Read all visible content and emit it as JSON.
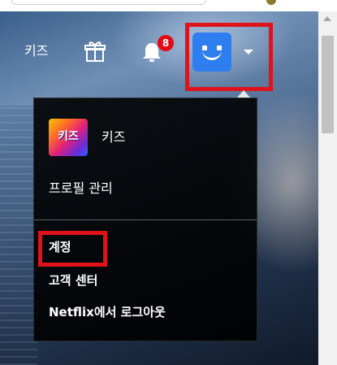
{
  "header": {
    "kids_link": "키즈",
    "gift_icon": "gift-icon",
    "notifications": {
      "icon": "bell-icon",
      "badge_count": "8"
    },
    "profile": {
      "avatar_color": "#2e7ef0",
      "caret_icon": "caret-down-icon"
    }
  },
  "dropdown": {
    "profiles": [
      {
        "tile_text": "키즈",
        "label": "키즈"
      }
    ],
    "manage_profiles": "프로필 관리",
    "links": {
      "account": "계정",
      "help_center": "고객 센터",
      "sign_out": "Netflix에서 로그아웃"
    }
  },
  "colors": {
    "netflix_red": "#e50914",
    "highlight_box": "#e0121a",
    "menu_bg": "#000000"
  }
}
